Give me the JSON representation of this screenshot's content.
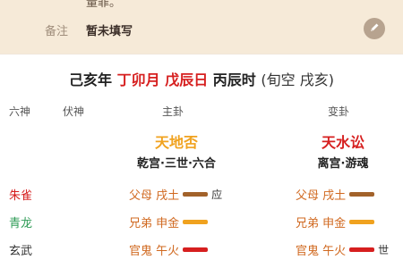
{
  "top": {
    "cut_text": "量罪。",
    "note_label": "备注",
    "note_value": "暂未填写",
    "edit_icon": "pencil-icon",
    "band_color": "#f6ead8"
  },
  "datetime": {
    "year": "己亥年",
    "month": "丁卯月",
    "day": "戊辰日",
    "hour": "丙辰时",
    "xunkong": "(旬空 戌亥)"
  },
  "headers": {
    "liushen": "六神",
    "fushen": "伏神",
    "main": "主卦",
    "change": "变卦"
  },
  "main_gua": {
    "name": "天地否",
    "desc": "乾宫·三世·六合",
    "color": "#f0a21f"
  },
  "change_gua": {
    "name": "天水讼",
    "desc": "离宫·游魂",
    "color": "#d61f1f"
  },
  "rows": [
    {
      "liushen": "朱雀",
      "liushen_color": "#d61f1f",
      "main": {
        "text": "父母 戌土",
        "bar": "brown",
        "mark": "应"
      },
      "change": {
        "text": "父母 戌土",
        "bar": "brown",
        "mark": ""
      }
    },
    {
      "liushen": "青龙",
      "liushen_color": "#2e9b56",
      "main": {
        "text": "兄弟 申金",
        "bar": "orange",
        "mark": ""
      },
      "change": {
        "text": "兄弟 申金",
        "bar": "orange",
        "mark": ""
      }
    },
    {
      "liushen": "玄武",
      "liushen_color": "#333333",
      "main": {
        "text": "官鬼 午火",
        "bar": "red",
        "mark": ""
      },
      "change": {
        "text": "官鬼 午火",
        "bar": "red",
        "mark": "世"
      }
    }
  ]
}
